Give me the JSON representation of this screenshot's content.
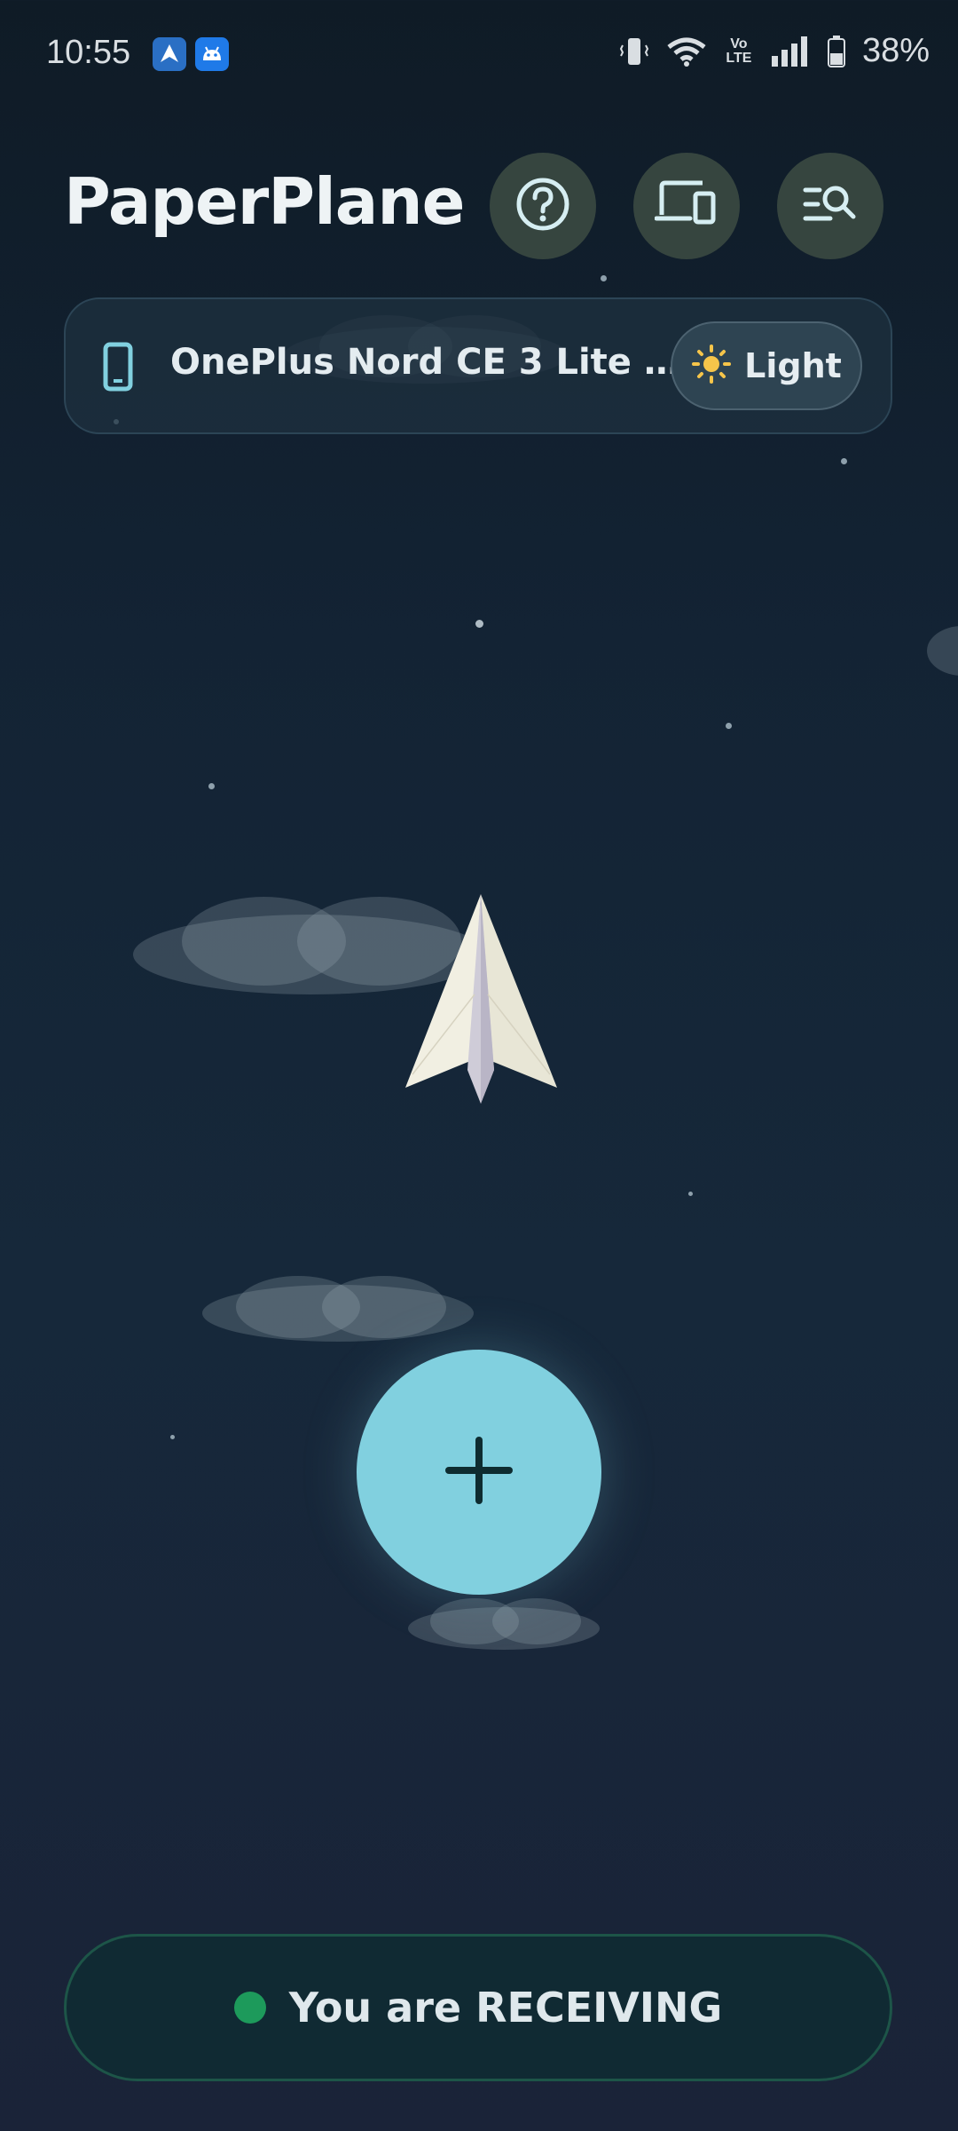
{
  "status_bar": {
    "time": "10:55",
    "battery_percent": "38%",
    "network_label": "Vo LTE"
  },
  "header": {
    "title": "PaperPlane"
  },
  "device_card": {
    "device_name": "OnePlus Nord CE 3 Lite 5...",
    "theme_label": "Light"
  },
  "receive_status": {
    "text": "You are RECEIVING",
    "dot_color": "#1d9a5b"
  },
  "colors": {
    "accent": "#81d0df",
    "background": "#132334"
  }
}
